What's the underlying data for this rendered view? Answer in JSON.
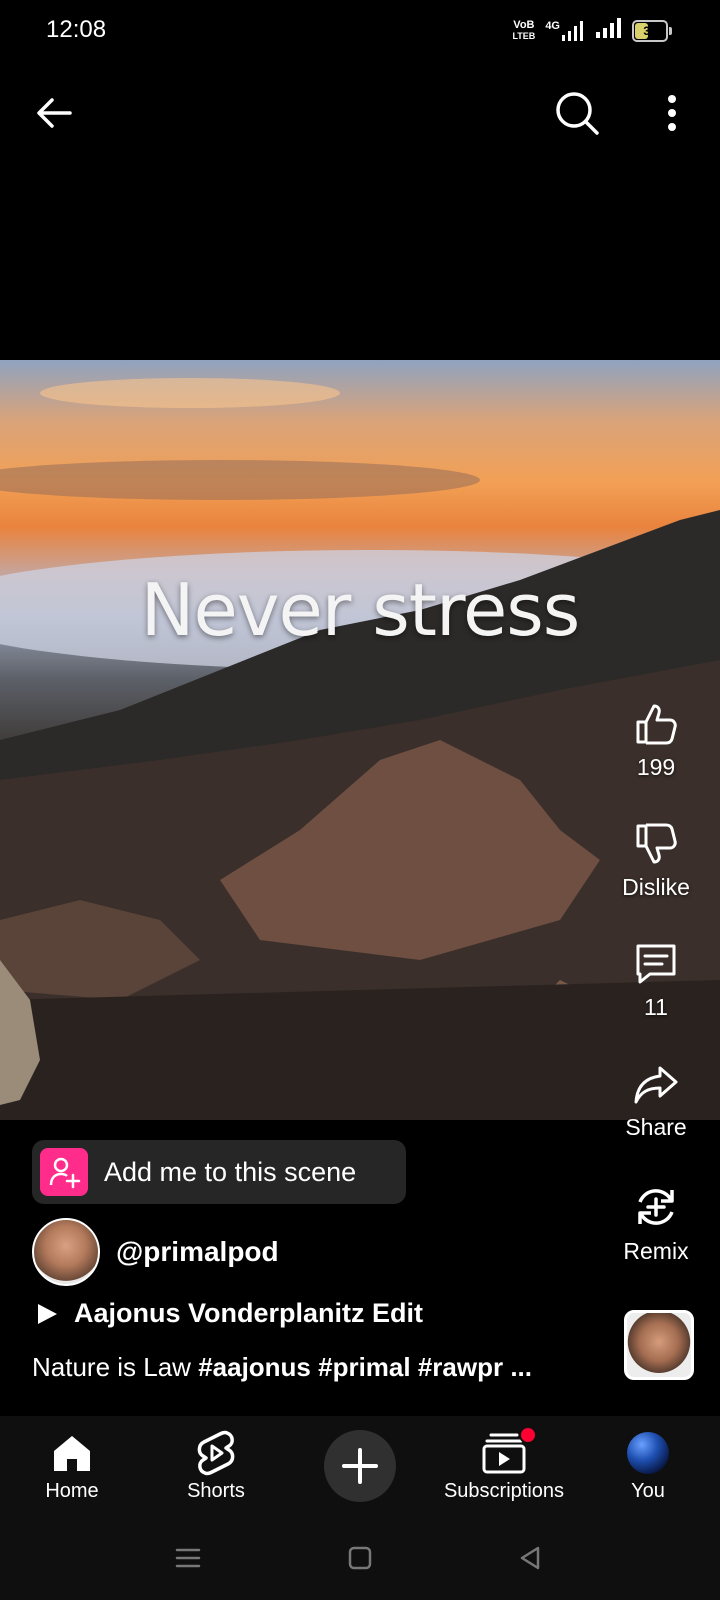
{
  "status_bar": {
    "time": "12:08",
    "net_label_top": "VoB",
    "net_label_bottom": "LTEB",
    "network": "4G",
    "battery": "35"
  },
  "top_bar": {
    "back_icon": "back-arrow-icon",
    "search_icon": "search-icon",
    "more_icon": "more-vert-icon"
  },
  "video": {
    "overlay_text": "Never stress"
  },
  "actions": {
    "like_count": "199",
    "dislike_label": "Dislike",
    "comment_count": "11",
    "share_label": "Share",
    "remix_label": "Remix"
  },
  "info": {
    "scene_chip_label": "Add me to this scene",
    "channel_handle": "@primalpod",
    "title": "Aajonus Vonderplanitz Edit",
    "description_plain": "Nature is Law ",
    "description_tags": "#aajonus #primal #rawpr ..."
  },
  "nav": {
    "home": "Home",
    "shorts": "Shorts",
    "subscriptions": "Subscriptions",
    "you": "You"
  },
  "colors": {
    "accent_pink": "#ff2c8c",
    "notification_red": "#ff0033",
    "background": "#000000"
  }
}
